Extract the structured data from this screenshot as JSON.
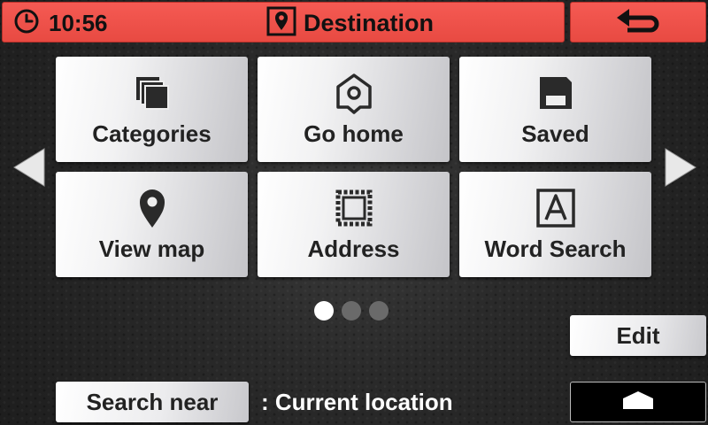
{
  "header": {
    "time": "10:56",
    "title": "Destination"
  },
  "tiles": [
    {
      "label": "Categories",
      "icon": "categories-icon"
    },
    {
      "label": "Go home",
      "icon": "home-pin-icon"
    },
    {
      "label": "Saved",
      "icon": "save-icon"
    },
    {
      "label": "View map",
      "icon": "map-pin-icon"
    },
    {
      "label": "Address",
      "icon": "stamp-icon"
    },
    {
      "label": "Word Search",
      "icon": "letter-a-icon"
    }
  ],
  "pagination": {
    "current": 1,
    "total": 3
  },
  "edit_label": "Edit",
  "search_near": {
    "label": "Search near",
    "value": ": Current location"
  },
  "colors": {
    "header": "#f55a53",
    "tile_light": "#ffffff",
    "tile_dark": "#c4c4c8",
    "background": "#2e2e2e"
  }
}
